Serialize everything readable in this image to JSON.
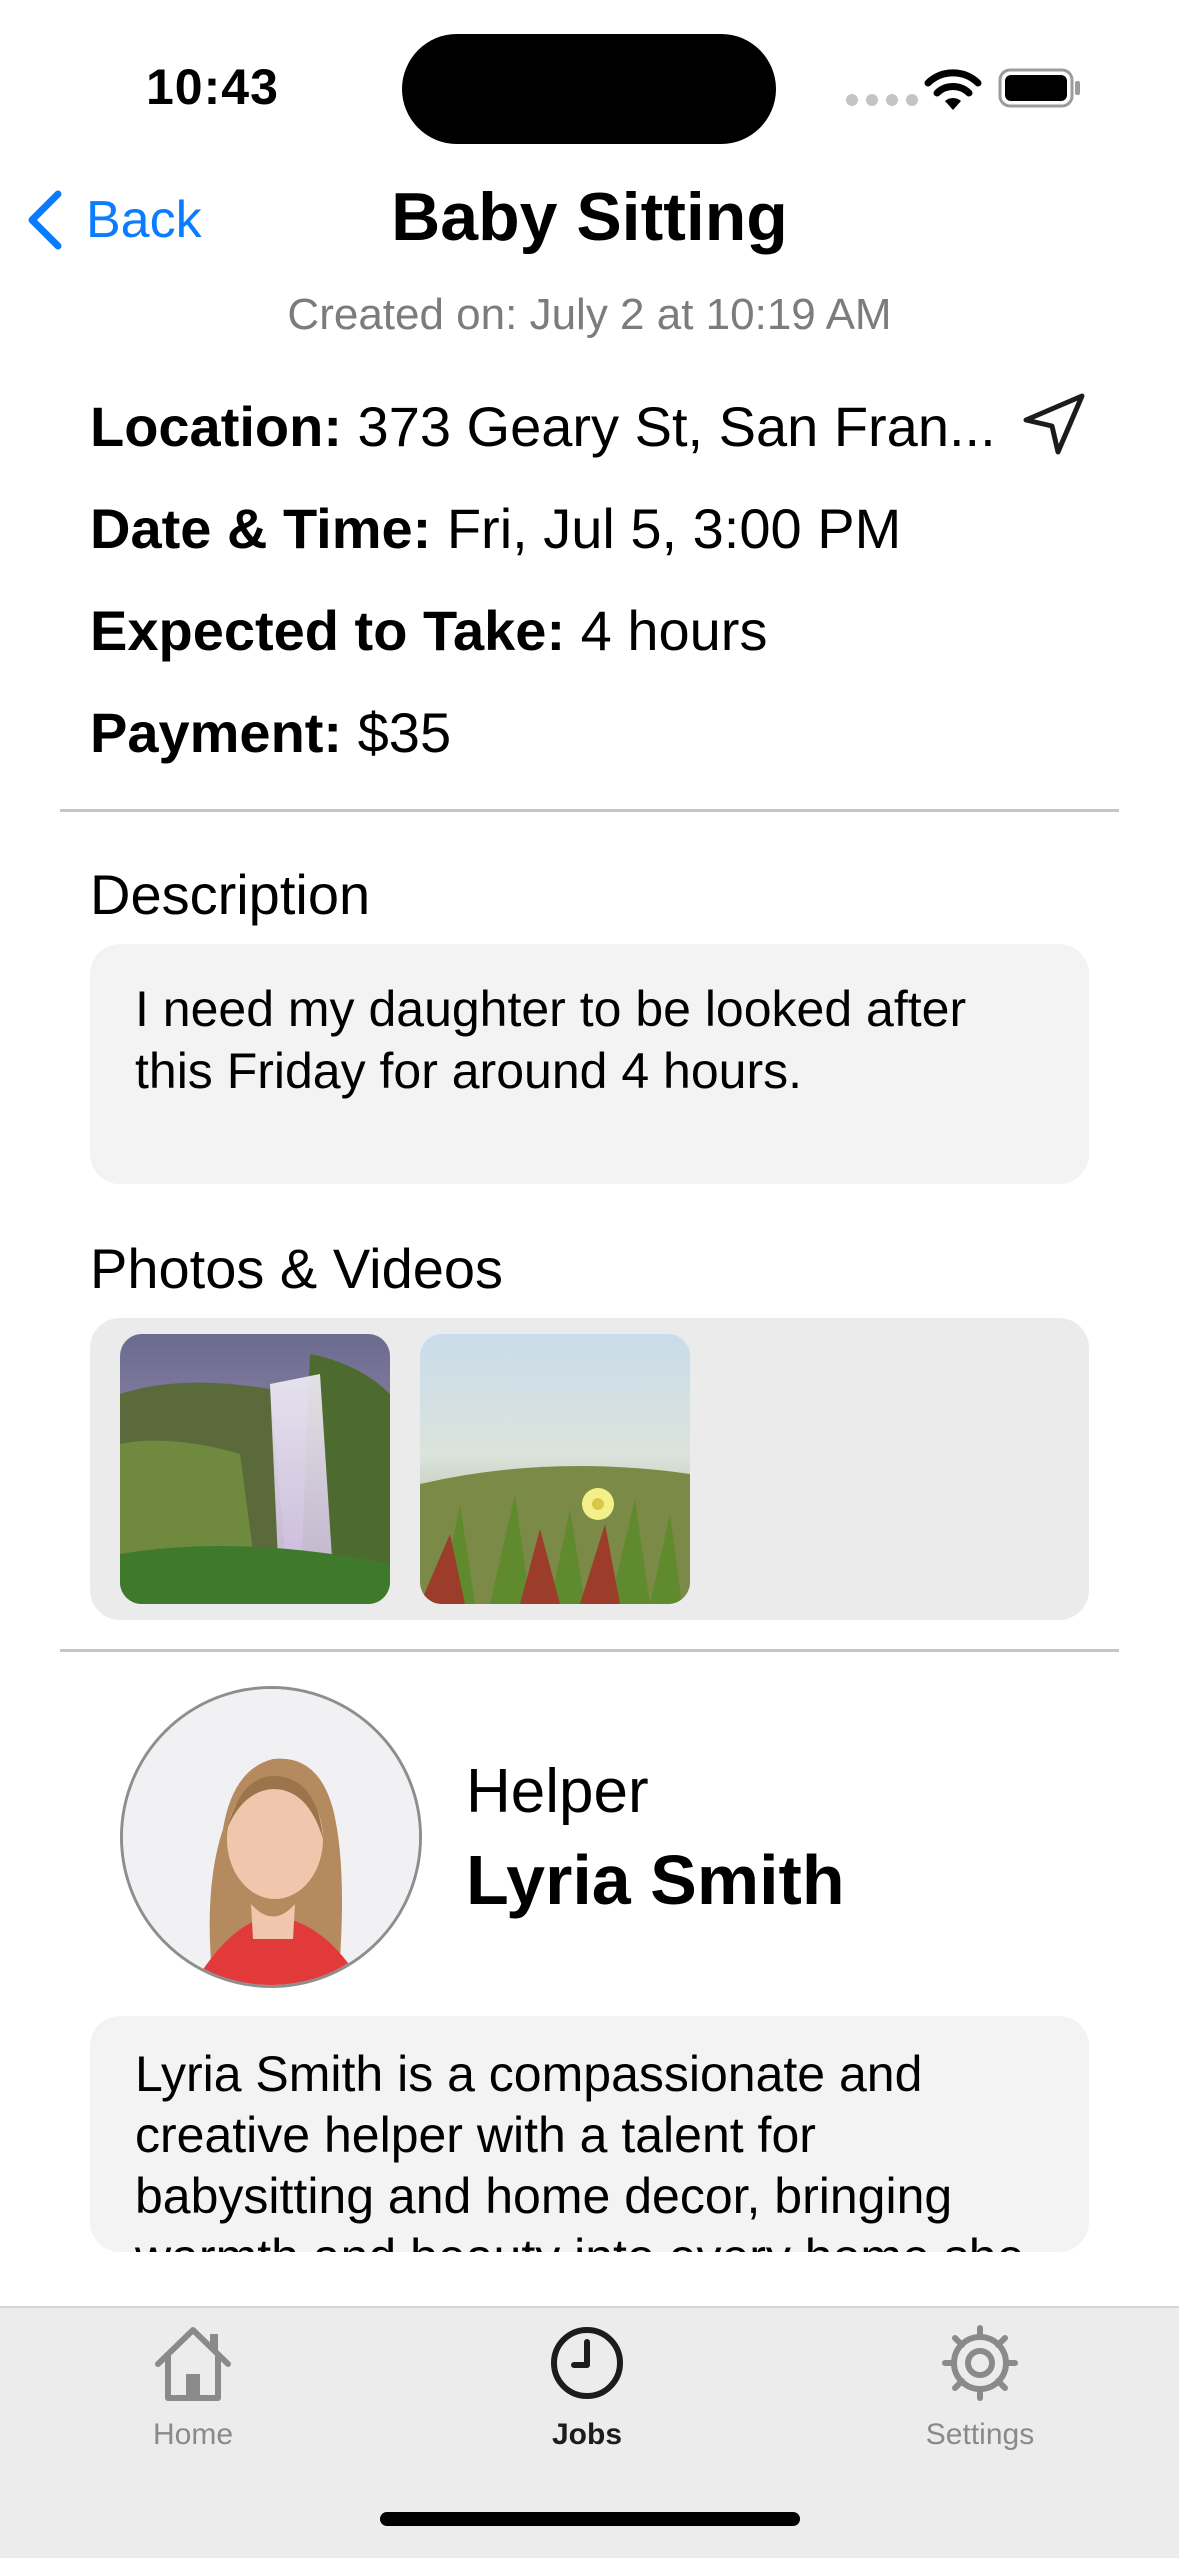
{
  "status_bar": {
    "time": "10:43"
  },
  "nav": {
    "back_label": "Back",
    "title": "Baby Sitting",
    "created": "Created on: July 2 at 10:19 AM"
  },
  "details": {
    "location_label": "Location:",
    "location_value": "373 Geary St, San Fran...",
    "datetime_label": "Date & Time:",
    "datetime_value": "Fri, Jul 5, 3:00 PM",
    "duration_label": "Expected to Take:",
    "duration_value": "4 hours",
    "payment_label": "Payment:",
    "payment_value": "$35"
  },
  "description": {
    "title": "Description",
    "text": "I need my daughter to be looked after this Friday for around 4 hours."
  },
  "media": {
    "title": "Photos & Videos",
    "items": [
      {
        "icon": "waterfall-photo"
      },
      {
        "icon": "flower-photo"
      }
    ]
  },
  "helper": {
    "label": "Helper",
    "name": "Lyria Smith",
    "bio": "Lyria Smith is a compassionate and creative helper with a talent for babysitting and home decor, bringing warmth and beauty into every home she"
  },
  "tabs": [
    {
      "label": "Home",
      "icon": "house-icon",
      "active": false
    },
    {
      "label": "Jobs",
      "icon": "clock-icon",
      "active": true
    },
    {
      "label": "Settings",
      "icon": "gear-icon",
      "active": false
    }
  ],
  "colors": {
    "accent": "#0a7cff",
    "secondary_text": "#7c7c7c",
    "card_bg": "#f3f3f3"
  }
}
